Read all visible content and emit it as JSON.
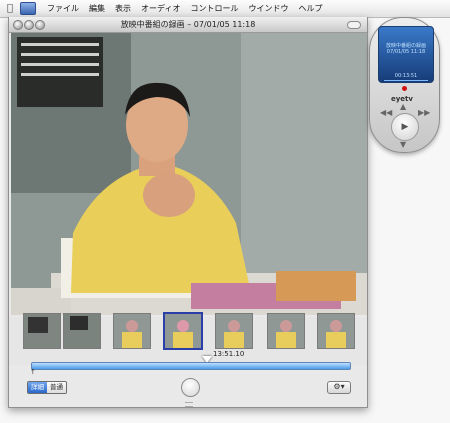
{
  "menubar": {
    "items": [
      "ファイル",
      "編集",
      "表示",
      "オーディオ",
      "コントロール",
      "ウインドウ",
      "ヘルプ"
    ]
  },
  "window": {
    "title": "放映中番組の録画 – 07/01/05 11:18"
  },
  "timeline": {
    "playhead_time": "13:51.10",
    "start_marker": "↑"
  },
  "toolbar": {
    "segment": [
      "詳細",
      "普通"
    ],
    "gear_label": "⚙▾"
  },
  "remote": {
    "title": "放映中番組の録画",
    "date": "07/01/05 11:18",
    "time": "00:13:51",
    "brand": "eyetv"
  },
  "colors": {
    "accent_blue": "#2a67c9",
    "rec_red": "#d41212"
  }
}
